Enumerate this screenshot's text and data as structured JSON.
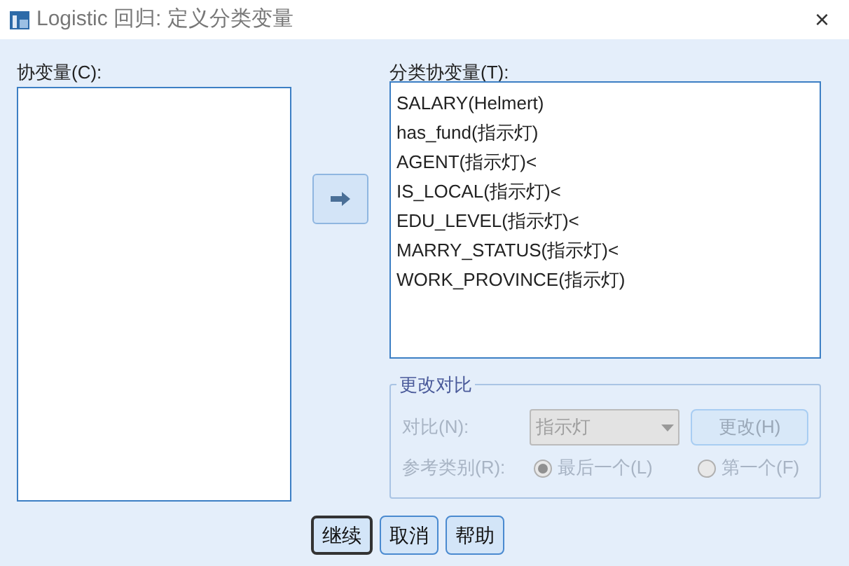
{
  "window": {
    "title": "Logistic 回归: 定义分类变量",
    "close": "×"
  },
  "covariates": {
    "label": "协变量(C):"
  },
  "move_button": {
    "disabled": false
  },
  "categorical": {
    "label": "分类协变量(T):",
    "items": [
      "SALARY(Helmert)",
      "has_fund(指示灯)",
      "AGENT(指示灯)<",
      "IS_LOCAL(指示灯)<",
      "EDU_LEVEL(指示灯)<",
      "MARRY_STATUS(指示灯)<",
      "WORK_PROVINCE(指示灯)"
    ]
  },
  "change_contrast": {
    "title": "更改对比",
    "disabled": true,
    "contrast_label": "对比(N):",
    "contrast_value": "指示灯",
    "change_button": "更改(H)",
    "reference_label": "参考类别(R):",
    "reference_options": [
      {
        "label": "最后一个(L)",
        "selected": true
      },
      {
        "label": "第一个(F)",
        "selected": false
      }
    ]
  },
  "buttons": [
    {
      "label": "继续",
      "default": true
    },
    {
      "label": "取消",
      "default": false
    },
    {
      "label": "帮助",
      "default": false
    }
  ]
}
